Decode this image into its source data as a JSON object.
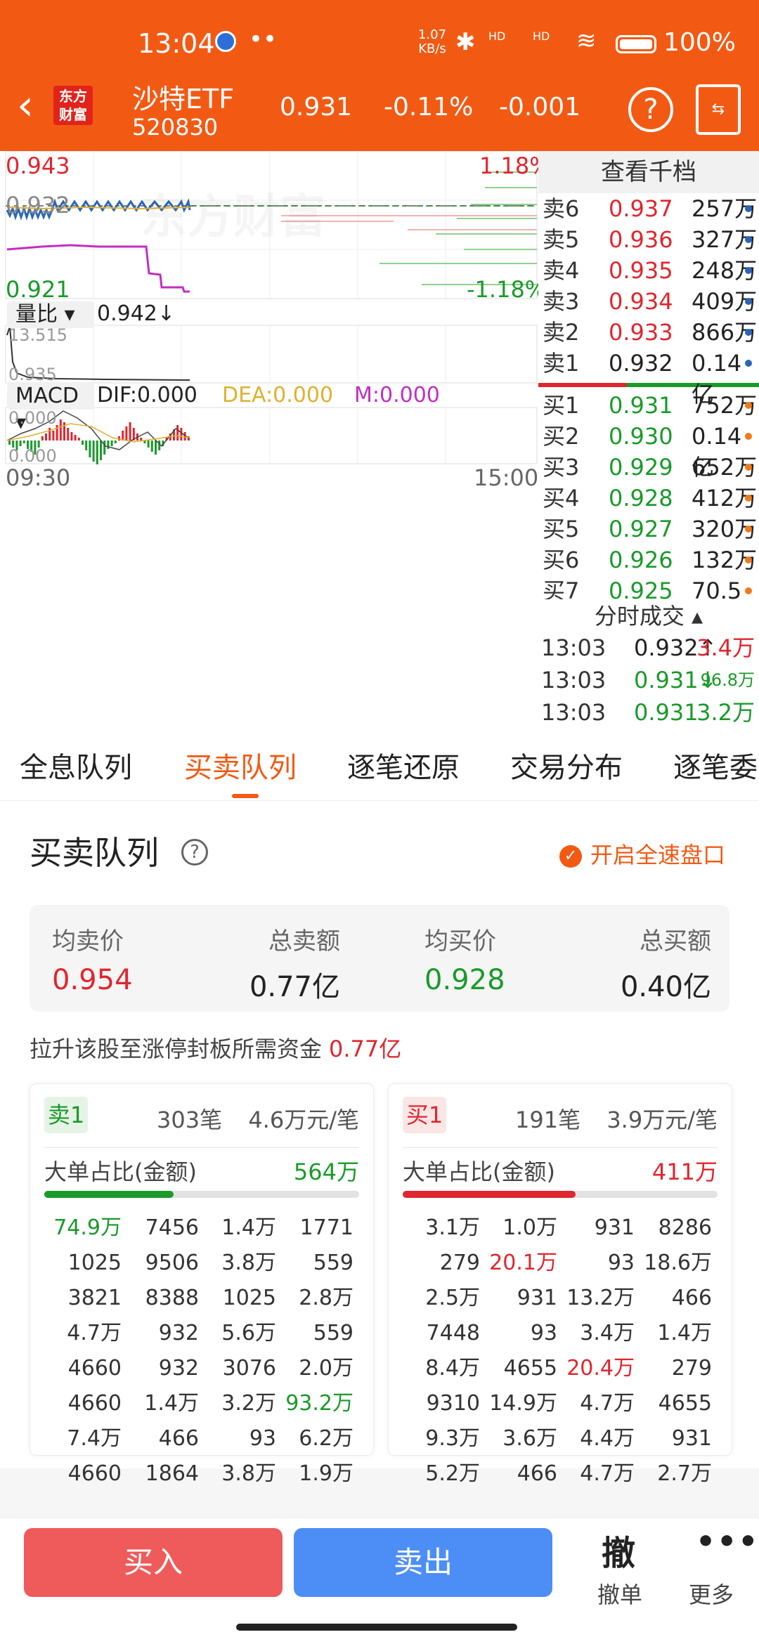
{
  "status_bar": {
    "time": "13:04",
    "dots": "••",
    "net_speed": "1.07\nKB/s",
    "sig1": "HD",
    "sig2": "HD",
    "battery": "100%"
  },
  "header": {
    "logo_text": "东方\n财富",
    "stock_name": "沙特ETF",
    "stock_code": "520830",
    "price": "0.931",
    "change_pct": "-0.11%",
    "change": "-0.001"
  },
  "chart": {
    "price_high": "0.943",
    "price_low": "0.921",
    "price_ref": "0.932",
    "pct_high": "1.18%",
    "pct_low": "-1.18%",
    "volume_ratio_label": "量比",
    "volume_ratio_value": "0.942",
    "volume_ratio_arrow": "↓",
    "vr_max": "13.515",
    "vr_min": "0.935",
    "macd_label": "MACD",
    "dif": "DIF:0.000",
    "dea": "DEA:0.000",
    "m": "M:0.000",
    "macd_top": "0.000",
    "macd_bottom": "0.000",
    "time_start": "09:30",
    "time_end": "15:00",
    "watermark": "东方财富"
  },
  "orderbook": {
    "title": "查看千档",
    "asks": [
      {
        "label": "卖6",
        "price": "0.937",
        "vol": "257万"
      },
      {
        "label": "卖5",
        "price": "0.936",
        "vol": "327万"
      },
      {
        "label": "卖4",
        "price": "0.935",
        "vol": "248万"
      },
      {
        "label": "卖3",
        "price": "0.934",
        "vol": "409万"
      },
      {
        "label": "卖2",
        "price": "0.933",
        "vol": "866万"
      },
      {
        "label": "卖1",
        "price": "0.932",
        "vol": "0.14亿"
      }
    ],
    "bids": [
      {
        "label": "买1",
        "price": "0.931",
        "vol": "752万"
      },
      {
        "label": "买2",
        "price": "0.930",
        "vol": "0.14亿"
      },
      {
        "label": "买3",
        "price": "0.929",
        "vol": "652万"
      },
      {
        "label": "买4",
        "price": "0.928",
        "vol": "412万"
      },
      {
        "label": "买5",
        "price": "0.927",
        "vol": "320万"
      },
      {
        "label": "买6",
        "price": "0.926",
        "vol": "132万"
      },
      {
        "label": "买7",
        "price": "0.925",
        "vol": "70.5万"
      }
    ],
    "ticks_title": "分时成交 ▴",
    "ticks": [
      {
        "time": "13:03",
        "price": "0.932↑",
        "vol": "3.4万"
      },
      {
        "time": "13:03",
        "price": "0.931↓",
        "vol": "96.8万"
      },
      {
        "time": "13:03",
        "price": "0.931",
        "vol": "3.2万"
      }
    ]
  },
  "tabs": [
    "全息队列",
    "买卖队列",
    "逐笔还原",
    "交易分布",
    "逐笔委"
  ],
  "queue": {
    "title": "买卖队列",
    "switch_label": "开启全速盘口",
    "avg_sell_label": "均卖价",
    "avg_sell": "0.954",
    "total_sell_label": "总卖额",
    "total_sell": "0.77亿",
    "avg_buy_label": "均买价",
    "avg_buy": "0.928",
    "total_buy_label": "总买额",
    "total_buy": "0.40亿",
    "need_label": "拉升该股至涨停封板所需资金",
    "need_value": "0.77亿",
    "sell_card": {
      "badge": "卖1",
      "count": "303笔",
      "avg": "4.6万元/笔",
      "big_label": "大单占比(金额)",
      "big_value": "564万",
      "big_ratio": 0.41,
      "rows": [
        [
          "74.9万",
          "7456",
          "1.4万",
          "1771"
        ],
        [
          "1025",
          "9506",
          "3.8万",
          "559"
        ],
        [
          "3821",
          "8388",
          "1025",
          "2.8万"
        ],
        [
          "4.7万",
          "932",
          "5.6万",
          "559"
        ],
        [
          "4660",
          "932",
          "3076",
          "2.0万"
        ],
        [
          "4660",
          "1.4万",
          "3.2万",
          "93.2万"
        ],
        [
          "7.4万",
          "466",
          "93",
          "6.2万"
        ],
        [
          "4660",
          "1864",
          "3.8万",
          "1.9万"
        ]
      ]
    },
    "buy_card": {
      "badge": "买1",
      "count": "191笔",
      "avg": "3.9万元/笔",
      "big_label": "大单占比(金额)",
      "big_value": "411万",
      "big_ratio": 0.55,
      "rows": [
        [
          "3.1万",
          "1.0万",
          "931",
          "8286"
        ],
        [
          "279",
          "20.1万",
          "93",
          "18.6万"
        ],
        [
          "2.5万",
          "931",
          "13.2万",
          "466"
        ],
        [
          "7448",
          "93",
          "3.4万",
          "1.4万"
        ],
        [
          "8.4万",
          "4655",
          "20.4万",
          "279"
        ],
        [
          "9310",
          "14.9万",
          "4.7万",
          "4655"
        ],
        [
          "9.3万",
          "3.6万",
          "4.4万",
          "931"
        ],
        [
          "5.2万",
          "466",
          "4.7万",
          "2.7万"
        ]
      ]
    }
  },
  "bottom": {
    "buy": "买入",
    "sell": "卖出",
    "cancel_icon": "撤",
    "cancel": "撤单",
    "more_icon": "•••",
    "more": "更多"
  },
  "colors": {
    "brand": "#f25a14",
    "up": "#e0262e",
    "down": "#1a9a2a",
    "buy_button": "#ef5a5a",
    "sell_button": "#4d8ef6"
  }
}
